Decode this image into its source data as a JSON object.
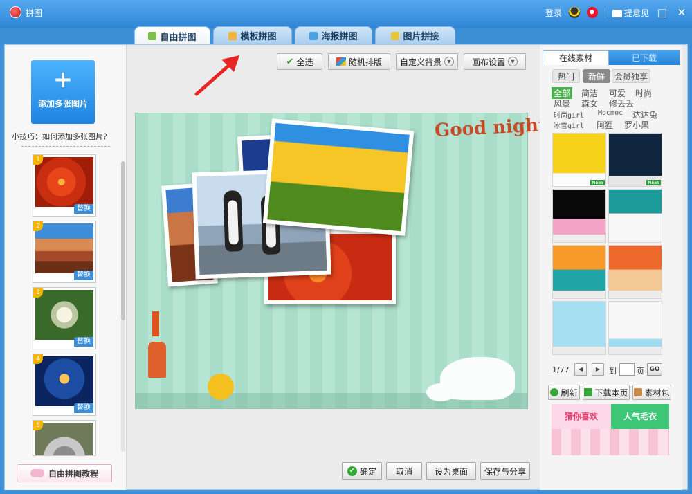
{
  "window": {
    "title": "拼图",
    "login": "登录",
    "feedback": "提意见",
    "minimize": "□",
    "close": "✕"
  },
  "tabs": [
    "自由拼图",
    "模板拼图",
    "海报拼图",
    "图片拼接"
  ],
  "left": {
    "add_button": "添加多张图片",
    "add_plus": "+",
    "tip": "小技巧：如何添加多张图片？",
    "thumbs": [
      {
        "num": "1",
        "swap": "替换"
      },
      {
        "num": "2",
        "swap": "替换"
      },
      {
        "num": "3",
        "swap": "替换"
      },
      {
        "num": "4",
        "swap": "替换"
      },
      {
        "num": "5"
      }
    ],
    "tutorial": "自由拼图教程"
  },
  "toolbar": {
    "select_all": "全选",
    "random": "随机排版",
    "custom_bg": "自定义背景",
    "canvas_settings": "画布设置"
  },
  "canvas": {
    "greeting": "Good night"
  },
  "bottom": {
    "confirm": "确定",
    "cancel": "取消",
    "set_desktop": "设为桌面",
    "save_share": "保存与分享"
  },
  "right": {
    "tab_online": "在线素材",
    "tab_downloaded": "已下载",
    "sub_hot": "热门",
    "sub_new": "新鲜",
    "sub_vip": "会员独享",
    "categories": [
      "全部",
      "简洁",
      "可爱",
      "时尚",
      "风景",
      "森女",
      "修丢丢",
      "时尚girl",
      "Mocmoc",
      "达达兔",
      "冰雪girl",
      "阿狸",
      "罗小黑"
    ],
    "new_badge": "NEW",
    "page": "1/77",
    "goto": "到",
    "page_unit": "页",
    "go": "GO",
    "prev": "◀",
    "next": "▶",
    "refresh": "刷新",
    "download_page": "下载本页",
    "asset_pack": "素材包",
    "promo_a": "猜你喜欢",
    "promo_b": "人气毛衣"
  },
  "colors": {
    "accent": "#2f86d6",
    "canvas_bg": "#a9dcc9",
    "arrow": "#e82525"
  }
}
